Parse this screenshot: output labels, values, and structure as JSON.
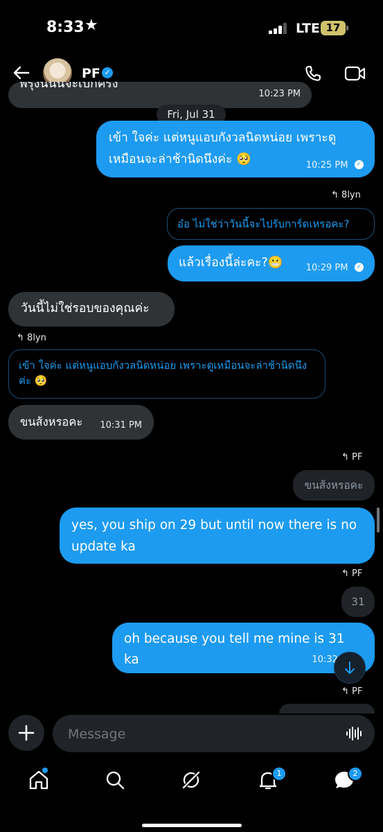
{
  "status_bar": {
    "time": "8:33",
    "network": "LTE",
    "battery": "17",
    "battery_color": "#cfc26b"
  },
  "header": {
    "contact_name": "PF",
    "icons": {
      "back": "arrow-left-icon",
      "verified": "verified-badge-icon",
      "call": "phone-icon",
      "video": "video-camera-icon"
    }
  },
  "conversation": {
    "top_partial_message": {
      "text": "พรุ่งนี้นั้นจะเบิกครั้ง",
      "time": "10:23 PM"
    },
    "date_separator": "Fri, Jul 31",
    "messages": [
      {
        "direction": "out",
        "text": "เข้า ใจค่ะ แต่หนูแอบกังวลนิดหน่อย เพราะดูเหมือนจะล่าช้านิดนึงค่ะ 🥺",
        "time": "10:25 PM"
      },
      {
        "direction": "out",
        "reply_to": "8lyn",
        "quoted": "อ๋อ ไม่ใช่ว่าวันนี้จะไปรับการ์ดเหรอคะ?",
        "text": "แล้วเรื่องนี้ล่ะคะ?😬",
        "time": "10:29 PM"
      },
      {
        "direction": "in",
        "text": "วันนี้ไม่ใช่รอบของคุณค่ะ"
      },
      {
        "direction": "in",
        "reply_to": "8lyn",
        "quoted": "เข้า ใจค่ะ แต่หนูแอบกังวลนิดหน่อย เพราะดูเหมือนจะล่าช้านิดนึงค่ะ 🥺",
        "text": "ขนส้งหรอคะ",
        "time": "10:31 PM"
      },
      {
        "direction": "out",
        "reply_to": "PF",
        "quoted": "ขนส้งหรอคะ",
        "text": "yes, you ship on 29 but until now there is no update ka"
      },
      {
        "direction": "out",
        "reply_to": "PF",
        "quoted": "31",
        "text": "oh because you tell me mine is 31 ka",
        "time": "10:32 PM"
      },
      {
        "direction": "out",
        "reply_to": "PF"
      }
    ]
  },
  "composer": {
    "placeholder": "Message",
    "icons": {
      "add": "plus-icon",
      "voice": "audio-waveform-icon"
    }
  },
  "bottom_nav": {
    "items": [
      {
        "name": "home",
        "icon": "home-icon",
        "has_dot": true
      },
      {
        "name": "search",
        "icon": "search-icon"
      },
      {
        "name": "grok",
        "icon": "grok-icon"
      },
      {
        "name": "notifications",
        "icon": "bell-icon",
        "badge": "1"
      },
      {
        "name": "messages",
        "icon": "messages-icon",
        "badge": "2"
      }
    ]
  },
  "colors": {
    "accent": "#1d9bf0",
    "incoming_bubble": "#2f3336",
    "background": "#000000"
  }
}
